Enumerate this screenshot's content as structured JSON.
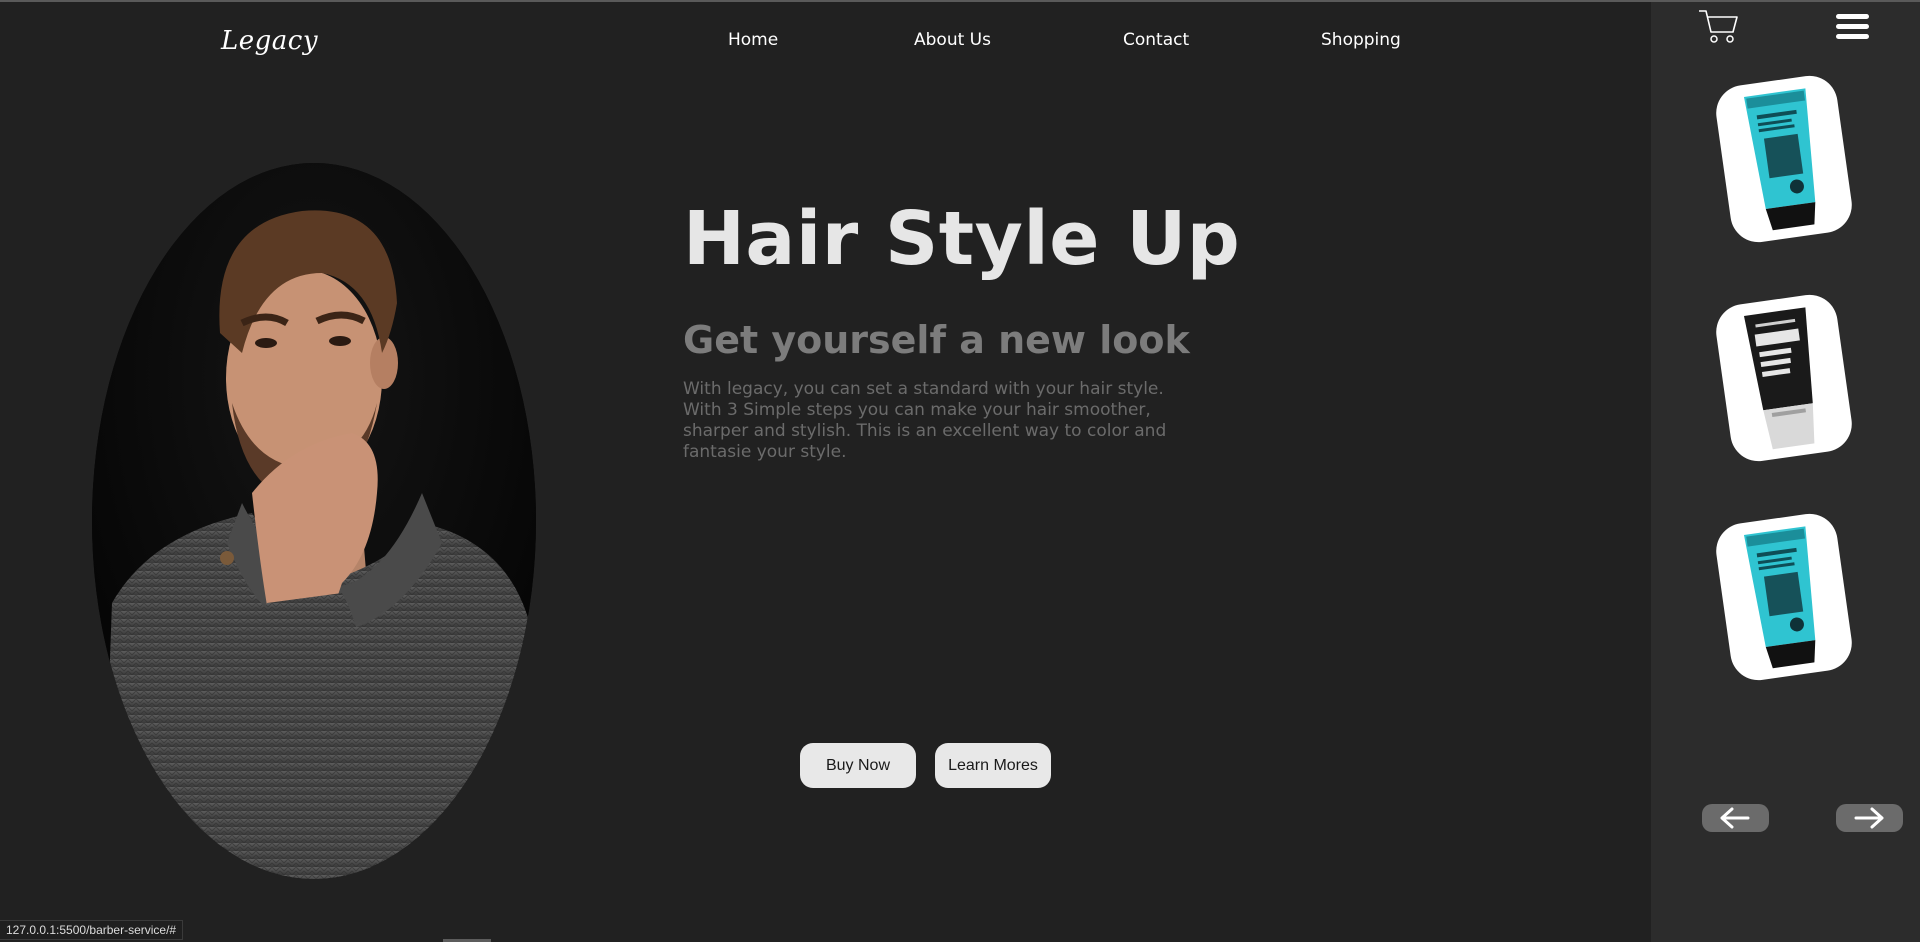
{
  "brand": {
    "name": "Legacy"
  },
  "nav": {
    "items": [
      {
        "label": "Home"
      },
      {
        "label": "About Us"
      },
      {
        "label": "Contact"
      },
      {
        "label": "Shopping"
      }
    ]
  },
  "hero": {
    "title": "Hair Style Up",
    "subtitle": "Get yourself a new look",
    "description": "With legacy, you can set a standard with your hair style. With 3 Simple steps you can make your hair smoother, sharper and stylish. This is an excellent way to color and fantasie your style.",
    "buy_label": "Buy Now",
    "learn_label": "Learn Mores",
    "image_icon": "man-portrait-image"
  },
  "sidebar": {
    "cart_icon": "shopping-cart-icon",
    "menu_icon": "hamburger-menu-icon",
    "products": [
      {
        "icon": "hair-styling-gel-tube",
        "color": "#2fc4d1"
      },
      {
        "icon": "men-power-hold-tube",
        "color": "#1a1a1a"
      },
      {
        "icon": "hair-styling-gel-tube",
        "color": "#2fc4d1"
      }
    ],
    "prev_icon": "arrow-left-icon",
    "next_icon": "arrow-right-icon"
  },
  "status": {
    "url": "127.0.0.1:5500/barber-service/#"
  },
  "colors": {
    "background": "#212121",
    "panel": "#2c2c2c",
    "title": "#e6e6e6",
    "subtitle": "#7c7c7c",
    "button": "#e8e8e8"
  }
}
